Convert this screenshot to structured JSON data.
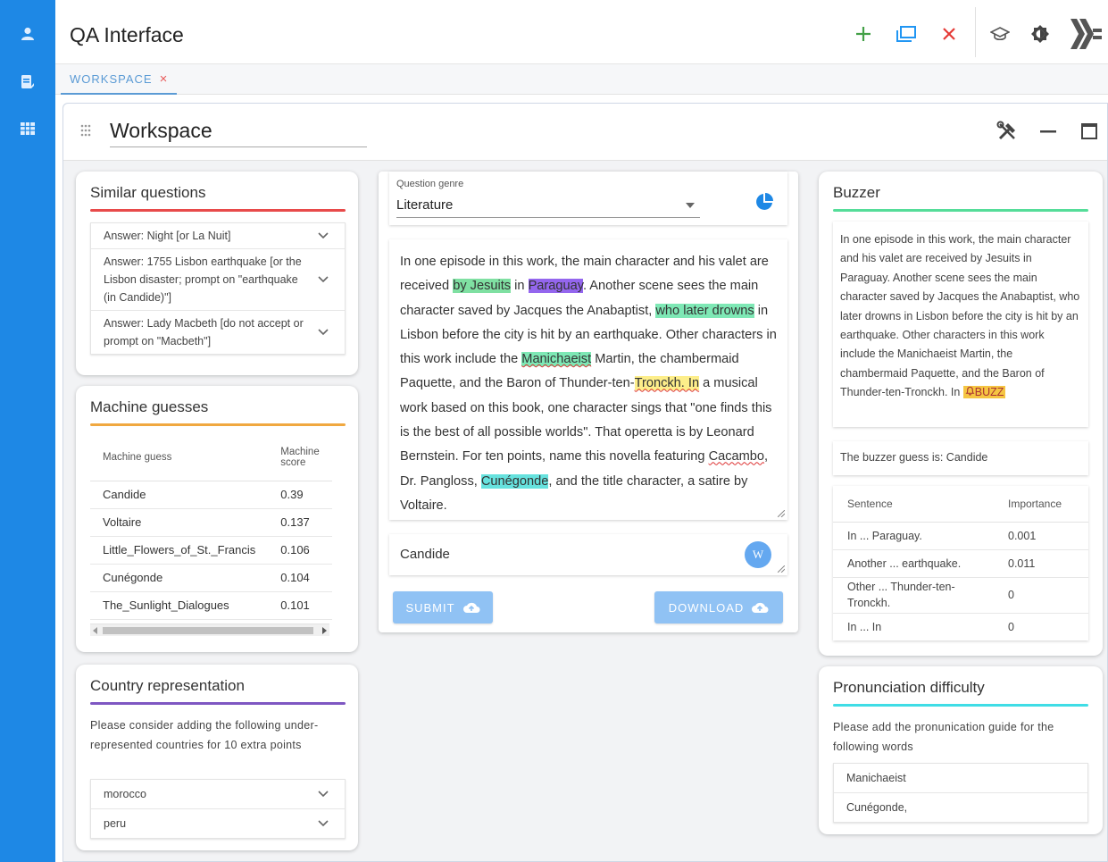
{
  "app": {
    "title": "QA Interface"
  },
  "tab": {
    "label": "WORKSPACE",
    "close": "×"
  },
  "workspace": {
    "title": "Workspace"
  },
  "similar": {
    "title": "Similar questions",
    "items": [
      "Answer: Night [or La Nuit]",
      "Answer: 1755 Lisbon earthquake [or the Lisbon disaster; prompt on \"earthquake (in Candide)\"]",
      "Answer: Lady Macbeth [do not accept or prompt on \"Macbeth\"]"
    ]
  },
  "machine": {
    "title": "Machine guesses",
    "col_guess": "Machine guess",
    "col_score": "Machine score",
    "rows": [
      {
        "guess": "Candide",
        "score": "0.39"
      },
      {
        "guess": "Voltaire",
        "score": "0.137"
      },
      {
        "guess": "Little_Flowers_of_St._Francis",
        "score": "0.106"
      },
      {
        "guess": "Cunégonde",
        "score": "0.104"
      },
      {
        "guess": "The_Sunlight_Dialogues",
        "score": "0.101"
      }
    ]
  },
  "country": {
    "title": "Country representation",
    "message": "Please consider adding the following under-represented countries for 10 extra points",
    "items": [
      "morocco",
      "peru"
    ]
  },
  "genre": {
    "label": "Question genre",
    "value": "Literature"
  },
  "question": {
    "s1": "In one episode in this work, the main character and his valet are received ",
    "h1": "by Jesuits",
    "s2": " in ",
    "h2": "Paraguay",
    "s3": ". Another scene sees the main character saved by Jacques the Anabaptist, ",
    "h3": "who later drowns",
    "s4": " in Lisbon before the city is hit by an earthquake. Other characters in this work include the ",
    "h4": "Manichaeist",
    "s5": " Martin, the chambermaid Paquette, and the Baron of Thunder-ten-",
    "h5": "Tronckh. In",
    "s6": " a musical work based on this book, one character sings that \"one finds this is the best of all possible worlds\". That operetta is by Leonard Bernstein. For ten points, name this novella featuring ",
    "w1": "Cacambo",
    "s7": ", Dr. Pangloss, ",
    "h6": "Cunégonde",
    "s8": ", and the title character, a satire by Voltaire."
  },
  "answer": {
    "value": "Candide",
    "badge": "W"
  },
  "buttons": {
    "submit": "SUBMIT",
    "download": "DOWNLOAD"
  },
  "buzzer": {
    "title": "Buzzer",
    "text": "In one episode in this work, the main character and his valet are received by Jesuits in Paraguay. Another scene sees the main character saved by Jacques the Anabaptist, who later drowns in Lisbon before the city is hit by an earthquake. Other characters in this work include the Manichaeist Martin, the chambermaid Paquette, and the Baron of Thunder-ten-Tronckh. In ",
    "buzz": "BUZZ",
    "guess": "The buzzer guess is: Candide",
    "col_sentence": "Sentence",
    "col_importance": "Importance",
    "rows": [
      {
        "sentence": "In ... Paraguay.",
        "importance": "0.001"
      },
      {
        "sentence": "Another ... earthquake.",
        "importance": "0.011"
      },
      {
        "sentence": "Other ... Thunder-ten-Tronckh.",
        "importance": "0"
      },
      {
        "sentence": "In ... In",
        "importance": "0"
      }
    ]
  },
  "pronunciation": {
    "title": "Pronunciation difficulty",
    "message": "Please add the pronunication guide for the following words",
    "items": [
      "Manichaeist",
      "Cunégonde,"
    ]
  },
  "colors": {
    "rail": "#1e88e5",
    "similar_rule": "#e84a4a",
    "machine_rule": "#f0a840",
    "country_rule": "#7e57c2",
    "buzzer_rule": "#55dd99",
    "pron_rule": "#40dde6",
    "button": "#90c2f4"
  }
}
